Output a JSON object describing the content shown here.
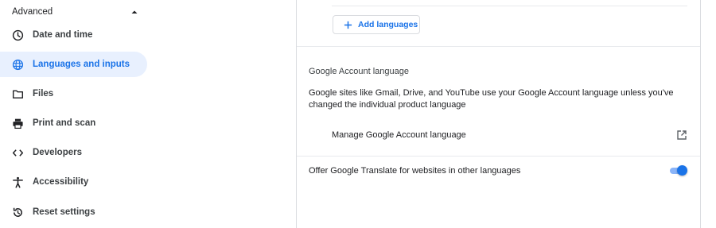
{
  "sidebar": {
    "advanced_label": "Advanced",
    "items": [
      {
        "label": "Date and time",
        "icon": "clock-icon"
      },
      {
        "label": "Languages and inputs",
        "icon": "globe-icon",
        "active": true
      },
      {
        "label": "Files",
        "icon": "folder-icon"
      },
      {
        "label": "Print and scan",
        "icon": "printer-icon"
      },
      {
        "label": "Developers",
        "icon": "code-icon"
      },
      {
        "label": "Accessibility",
        "icon": "accessibility-icon"
      },
      {
        "label": "Reset settings",
        "icon": "reset-icon"
      }
    ]
  },
  "main": {
    "add_languages_label": "Add languages",
    "account_language_title": "Google Account language",
    "account_language_desc": "Google sites like Gmail, Drive, and YouTube use your Google Account language unless you've changed the individual product language",
    "manage_label": "Manage Google Account language",
    "translate_label": "Offer Google Translate for websites in other languages",
    "translate_enabled": true
  },
  "colors": {
    "accent": "#1a73e8",
    "active_bg": "#e8f0fe",
    "divider": "#dadce0"
  }
}
